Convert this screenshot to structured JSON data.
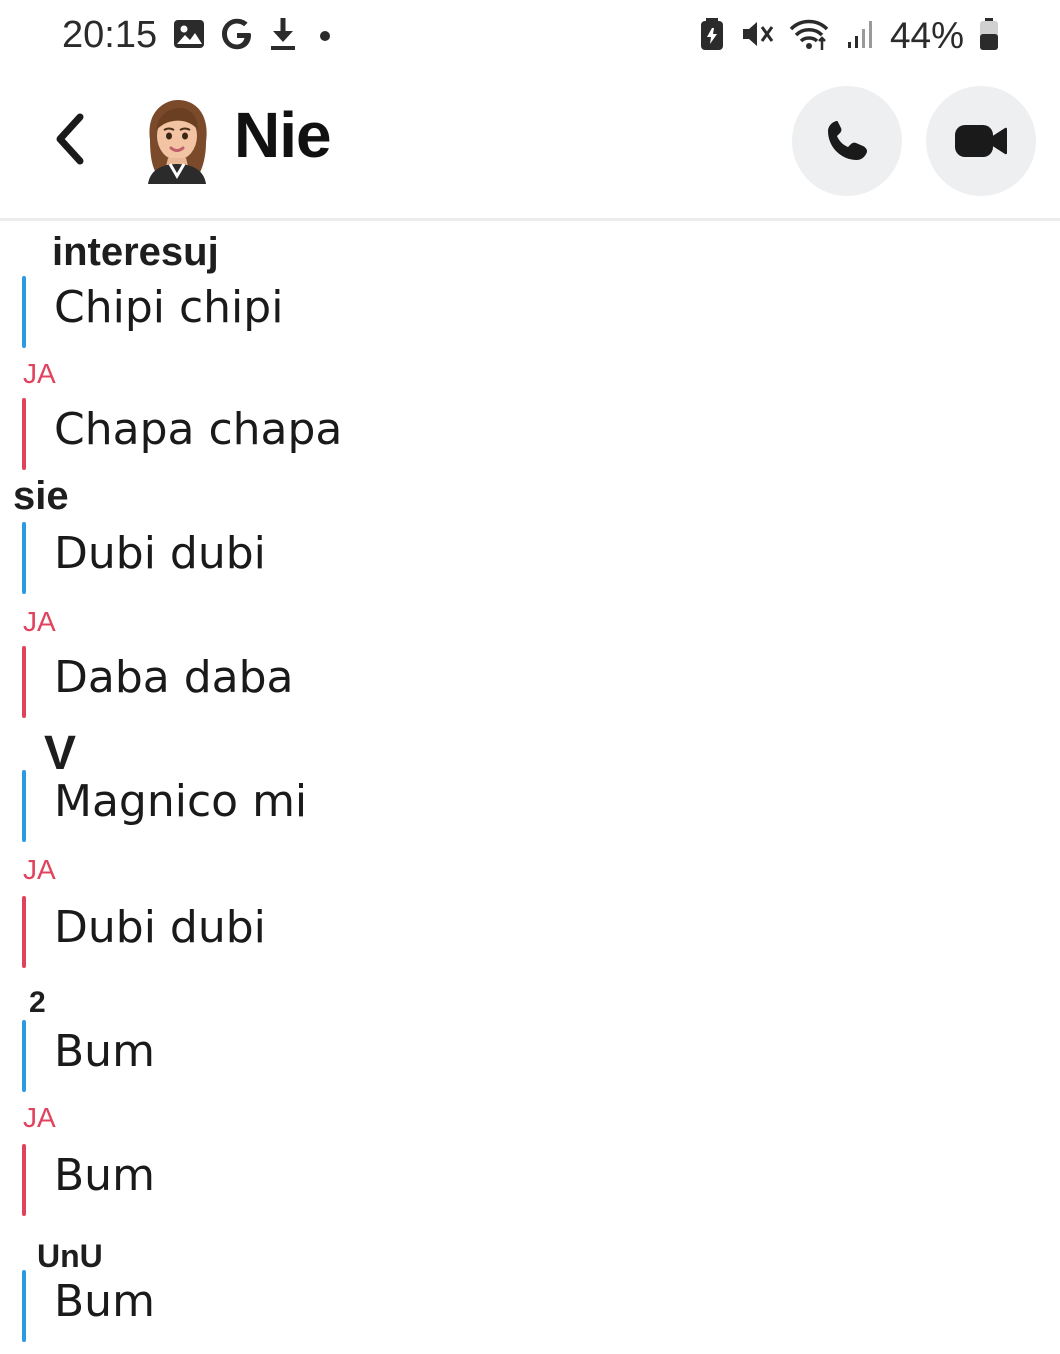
{
  "status_bar": {
    "time": "20:15",
    "battery": "44%",
    "left_icons": [
      "gallery-icon",
      "google-icon",
      "download-icon",
      "dot-icon"
    ],
    "right_icons": [
      "battery-saver-icon",
      "mute-icon",
      "wifi-icon",
      "signal-icon",
      "battery-icon"
    ]
  },
  "header": {
    "contact_name": "Nie",
    "back_icon": "chevron-left-icon",
    "call_icon": "phone-icon",
    "video_icon": "video-camera-icon"
  },
  "colors": {
    "me_accent": "#e0435c",
    "them_accent": "#2a9be0"
  },
  "messages": [
    {
      "sender": "interesuj",
      "from": "them",
      "text": "Chipi chipi"
    },
    {
      "sender": "JA",
      "from": "me",
      "text": "Chapa chapa"
    },
    {
      "sender": "sie",
      "from": "them",
      "text": "Dubi dubi"
    },
    {
      "sender": "JA",
      "from": "me",
      "text": "Daba daba"
    },
    {
      "sender": "V",
      "from": "them",
      "text": "Magnico mi"
    },
    {
      "sender": "JA",
      "from": "me",
      "text": "Dubi dubi"
    },
    {
      "sender": "2",
      "from": "them",
      "text": "Bum"
    },
    {
      "sender": "JA",
      "from": "me",
      "text": "Bum"
    },
    {
      "sender": "UnU",
      "from": "them",
      "text": "Bum"
    }
  ]
}
